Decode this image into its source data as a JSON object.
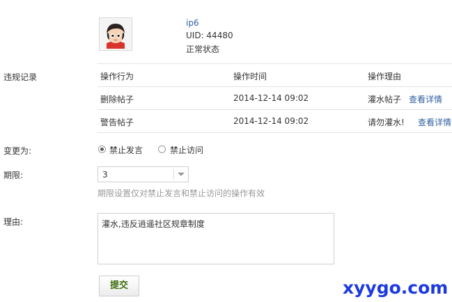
{
  "profile": {
    "name": "ip6",
    "uid": "UID: 44480",
    "status": "正常状态"
  },
  "violations": {
    "label": "违规记录",
    "headers": [
      "操作行为",
      "操作时间",
      "操作理由"
    ],
    "rows": [
      {
        "action": "删除帖子",
        "time": "2014-12-14 09:02",
        "reason": "灌水帖子",
        "detail": "查看详情"
      },
      {
        "action": "警告帖子",
        "time": "2014-12-14 09:02",
        "reason": "请勿灌水!",
        "detail": "查看详情"
      }
    ]
  },
  "change_to": {
    "label": "变更为:",
    "options": [
      {
        "label": "禁止发言",
        "checked": true
      },
      {
        "label": "禁止访问",
        "checked": false
      }
    ]
  },
  "duration": {
    "label": "期限:",
    "value": "3",
    "hint": "期限设置仅对禁止发言和禁止访问的操作有效"
  },
  "reason": {
    "label": "理由:",
    "value": "灌水,违反逍遥社区规章制度"
  },
  "submit_label": "提交",
  "watermark": "xyygo.com"
}
